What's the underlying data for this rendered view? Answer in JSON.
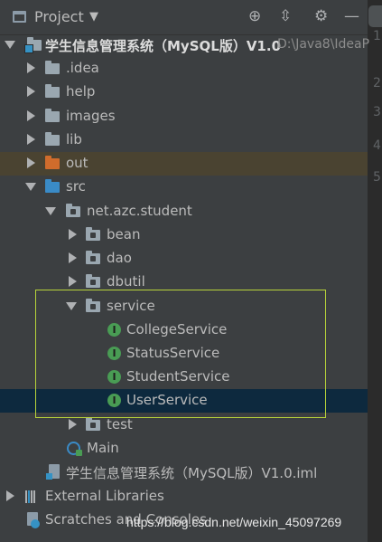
{
  "toolbar": {
    "title": "Project",
    "icons": [
      "project-view-icon",
      "dropdown-caret-icon",
      "locate-target-icon",
      "collapse-all-icon",
      "settings-gear-icon",
      "hide-panel-icon"
    ]
  },
  "editor": {
    "line_numbers": [
      "1",
      "2",
      "3",
      "4",
      "5"
    ]
  },
  "tree": {
    "root": {
      "label": "学生信息管理系统（MySQL版）V1.0",
      "path": "D:\\Java8\\IdeaP"
    },
    "idea": ".idea",
    "help": "help",
    "images": "images",
    "lib": "lib",
    "out": "out",
    "src": "src",
    "package": "net.azc.student",
    "bean": "bean",
    "dao": "dao",
    "dbutil": "dbutil",
    "service": "service",
    "service_items": [
      "CollegeService",
      "StatusService",
      "StudentService",
      "UserService"
    ],
    "test": "test",
    "main": "Main",
    "iml": "学生信息管理系统（MySQL版）V1.0.iml",
    "external": "External Libraries",
    "scratches": "Scratches and Consoles"
  },
  "watermark": "https://blog.csdn.net/weixin_45097269",
  "colors": {
    "highlight_box": "#b8d43a",
    "selected_row": "#0d293e",
    "excluded_row": "#4a4331"
  }
}
